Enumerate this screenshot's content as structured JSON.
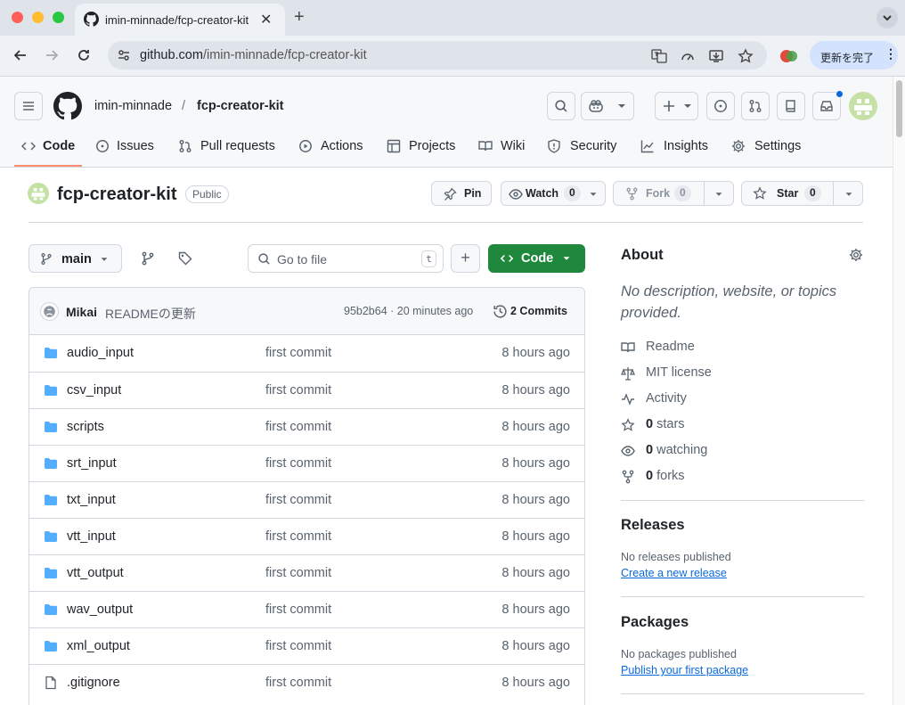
{
  "browser": {
    "tab_title": "imin-minnade/fcp-creator-kit",
    "url_host": "github.com",
    "url_path": "/imin-minnade/fcp-creator-kit",
    "update_label": "更新を完了",
    "update_menu": "⋮"
  },
  "header": {
    "owner": "imin-minnade",
    "separator": "/",
    "repo": "fcp-creator-kit"
  },
  "tabs": [
    {
      "label": "Code",
      "icon": "code-icon",
      "selected": true
    },
    {
      "label": "Issues",
      "icon": "issue-icon"
    },
    {
      "label": "Pull requests",
      "icon": "pull-request-icon"
    },
    {
      "label": "Actions",
      "icon": "play-icon"
    },
    {
      "label": "Projects",
      "icon": "table-icon"
    },
    {
      "label": "Wiki",
      "icon": "book-icon"
    },
    {
      "label": "Security",
      "icon": "shield-icon"
    },
    {
      "label": "Insights",
      "icon": "graph-icon"
    },
    {
      "label": "Settings",
      "icon": "gear-icon"
    }
  ],
  "repo_title": {
    "name": "fcp-creator-kit",
    "visibility": "Public",
    "pin_label": "Pin",
    "watch_label": "Watch",
    "watch_count": "0",
    "fork_label": "Fork",
    "fork_count": "0",
    "star_label": "Star",
    "star_count": "0"
  },
  "file_nav": {
    "branch": "main",
    "search_placeholder": "Go to file",
    "search_shortcut": "t",
    "add_label": "+",
    "code_label": "Code"
  },
  "commit": {
    "author": "Mikai",
    "message": "READMEの更新",
    "sha_time": "95b2b64 · 20 minutes ago",
    "commits_label": "2 Commits"
  },
  "files": [
    {
      "name": "audio_input",
      "type": "dir",
      "message": "first commit",
      "time": "8 hours ago"
    },
    {
      "name": "csv_input",
      "type": "dir",
      "message": "first commit",
      "time": "8 hours ago"
    },
    {
      "name": "scripts",
      "type": "dir",
      "message": "first commit",
      "time": "8 hours ago"
    },
    {
      "name": "srt_input",
      "type": "dir",
      "message": "first commit",
      "time": "8 hours ago"
    },
    {
      "name": "txt_input",
      "type": "dir",
      "message": "first commit",
      "time": "8 hours ago"
    },
    {
      "name": "vtt_input",
      "type": "dir",
      "message": "first commit",
      "time": "8 hours ago"
    },
    {
      "name": "vtt_output",
      "type": "dir",
      "message": "first commit",
      "time": "8 hours ago"
    },
    {
      "name": "wav_output",
      "type": "dir",
      "message": "first commit",
      "time": "8 hours ago"
    },
    {
      "name": "xml_output",
      "type": "dir",
      "message": "first commit",
      "time": "8 hours ago"
    },
    {
      "name": ".gitignore",
      "type": "file",
      "message": "first commit",
      "time": "8 hours ago"
    }
  ],
  "about": {
    "title": "About",
    "description": "No description, website, or topics provided.",
    "readme": "Readme",
    "license": "MIT license",
    "activity": "Activity",
    "stars_count": "0",
    "stars_label": " stars",
    "watching_count": "0",
    "watching_label": " watching",
    "forks_count": "0",
    "forks_label": " forks"
  },
  "releases": {
    "title": "Releases",
    "note": "No releases published",
    "link": "Create a new release"
  },
  "packages": {
    "title": "Packages",
    "note": "No packages published",
    "link": "Publish your first package"
  },
  "colors": {
    "accent_green": "#1f883d",
    "link_blue": "#0969da",
    "folder_blue": "#54aeff",
    "tab_underline": "#fd8c73"
  }
}
